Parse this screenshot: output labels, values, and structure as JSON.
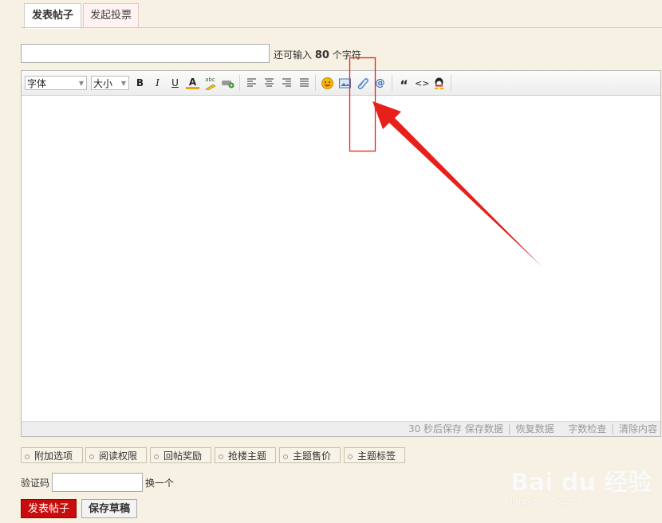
{
  "tabs": [
    {
      "label": "发表帖子",
      "active": true
    },
    {
      "label": "发起投票",
      "active": false
    }
  ],
  "title_field": {
    "value": "",
    "placeholder": ""
  },
  "char_hint": {
    "prefix": "还可输入",
    "count": "80",
    "suffix": "个字符"
  },
  "toolbar": {
    "font_select": "字体",
    "size_select": "大小",
    "bold": "B",
    "italic": "I",
    "underline": "U",
    "font_color": "A",
    "spellcheck": "abc",
    "at": "@",
    "quote": "“",
    "code": "<>"
  },
  "icons": [
    "bold-icon",
    "italic-icon",
    "underline-icon",
    "font-color-icon",
    "highlight-icon",
    "link-icon",
    "align-left-icon",
    "align-center-icon",
    "align-right-icon",
    "justify-icon",
    "emoji-icon",
    "image-icon",
    "attachment-icon",
    "at-icon",
    "quote-icon",
    "code-icon",
    "qq-icon"
  ],
  "status": {
    "autosave": "30 秒后保存",
    "save_data": "保存数据",
    "restore_data": "恢复数据",
    "word_check": "字数检查",
    "clear_content": "清除内容"
  },
  "options": [
    "附加选项",
    "阅读权限",
    "回帖奖励",
    "抢楼主题",
    "主题售价",
    "主题标签"
  ],
  "captcha": {
    "label": "验证码",
    "value": "",
    "refresh": "换一个"
  },
  "buttons": {
    "submit": "发表帖子",
    "draft": "保存草稿"
  },
  "watermark": {
    "brand": "Bai du 经验",
    "url": "jingyan.baidu.com"
  },
  "colors": {
    "accent_red": "#c70d0d",
    "annotation_red": "#e8201c",
    "page_bg": "#f6f1e2"
  }
}
